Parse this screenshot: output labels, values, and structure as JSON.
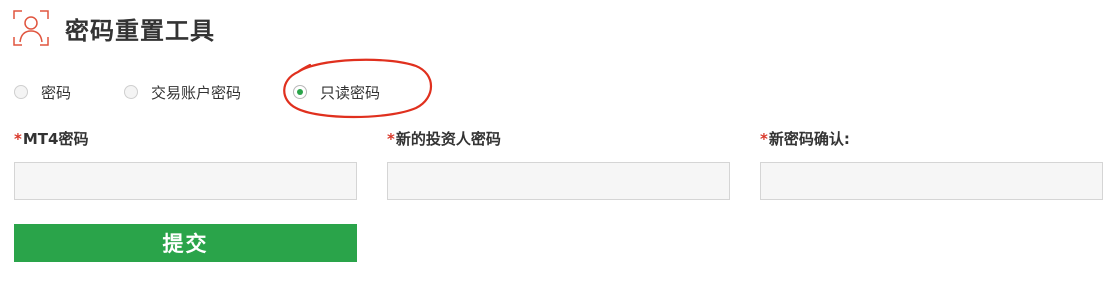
{
  "header": {
    "icon": "user-profile-icon",
    "title": "密码重置工具"
  },
  "password_type": {
    "options": [
      {
        "label": "密码",
        "selected": false
      },
      {
        "label": "交易账户密码",
        "selected": false
      },
      {
        "label": "只读密码",
        "selected": true
      }
    ]
  },
  "form": {
    "fields": [
      {
        "required_mark": "*",
        "label": "MT4密码",
        "value": "",
        "placeholder": ""
      },
      {
        "required_mark": "*",
        "label": "新的投资人密码",
        "value": "",
        "placeholder": ""
      },
      {
        "required_mark": "*",
        "label": "新密码确认:",
        "value": "",
        "placeholder": ""
      }
    ],
    "submit_label": "提交"
  },
  "colors": {
    "accent_green": "#2aa44a",
    "required_red": "#d9382a",
    "annotation_red": "#e0301e",
    "icon_red": "#e0553f"
  }
}
